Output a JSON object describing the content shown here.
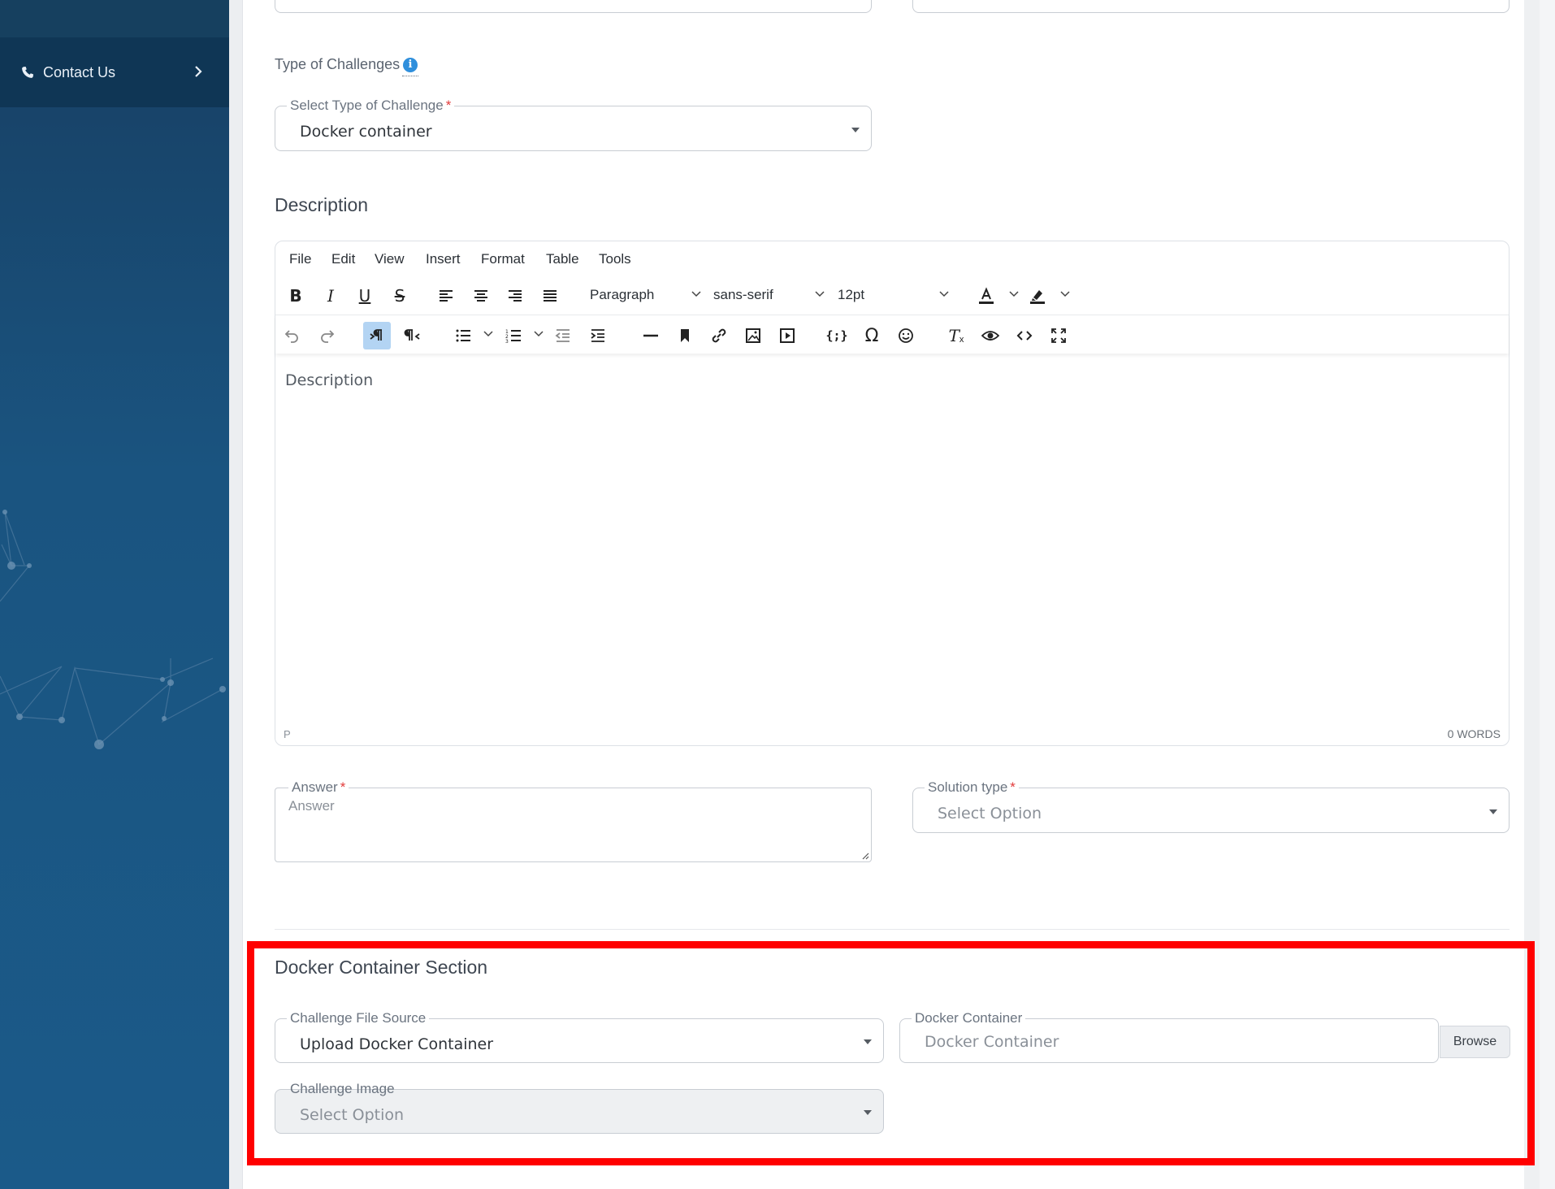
{
  "sidebar": {
    "contact_label": "Contact Us"
  },
  "form": {
    "type_of_challenges_label": "Type of Challenges",
    "select_type": {
      "label": "Select Type of Challenge",
      "required_mark": "*",
      "value": "Docker container"
    },
    "description_title": "Description",
    "editor": {
      "menu": [
        "File",
        "Edit",
        "View",
        "Insert",
        "Format",
        "Table",
        "Tools"
      ],
      "block_format": "Paragraph",
      "font_family": "sans-serif",
      "font_size": "12pt",
      "placeholder": "Description",
      "path": "P",
      "word_count": "0 WORDS"
    },
    "answer": {
      "label": "Answer",
      "required_mark": "*",
      "placeholder": "Answer"
    },
    "solution_type": {
      "label": "Solution type",
      "required_mark": "*",
      "value": "Select Option"
    }
  },
  "docker_section": {
    "title": "Docker Container Section",
    "file_source": {
      "label": "Challenge File Source",
      "value": "Upload Docker Container"
    },
    "docker_container": {
      "label": "Docker Container",
      "placeholder": "Docker Container",
      "browse_label": "Browse"
    },
    "challenge_image": {
      "label": "Challenge Image",
      "value": "Select Option"
    }
  },
  "colors": {
    "sidebar_bg": "#1a5480",
    "highlight_box": "#ff0000",
    "info_icon": "#2f8fdc",
    "required_star": "#e23b3b"
  }
}
